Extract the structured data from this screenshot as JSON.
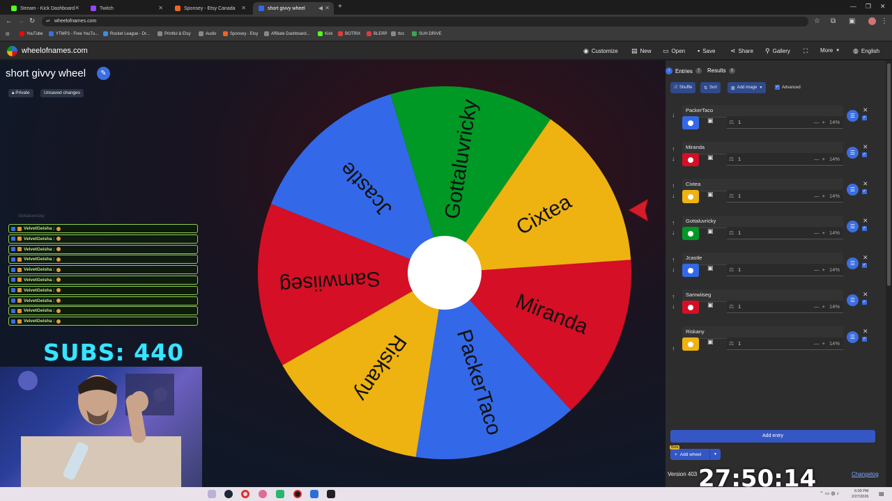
{
  "browser": {
    "tabs": [
      {
        "title": "Stream - Kick Dashboard",
        "color": "#53fc18"
      },
      {
        "title": "Twitch",
        "color": "#9146ff"
      },
      {
        "title": "Sponsey - Etsy Canada",
        "color": "#f1641e"
      },
      {
        "title": "short givvy wheel",
        "color": "#3369e8"
      }
    ],
    "url": "wheelofnames.com",
    "bookmarks": [
      {
        "label": "YouTube",
        "color": "#ff0000"
      },
      {
        "label": "YTMP3 - Free YouTu...",
        "color": "#3b6ee0"
      },
      {
        "label": "Rocket League - Dr...",
        "color": "#3b8ee0"
      },
      {
        "label": "Printful & Etsy",
        "color": "#888888"
      },
      {
        "label": "Audio",
        "color": "#888888"
      },
      {
        "label": "Sponsey - Etsy",
        "color": "#f1641e"
      },
      {
        "label": "Affiliate Dashboard...",
        "color": "#888888"
      },
      {
        "label": "Kick",
        "color": "#53fc18"
      },
      {
        "label": "BOTRIX",
        "color": "#e03b3b"
      },
      {
        "label": "BLERP",
        "color": "#e03b3b"
      },
      {
        "label": "ttcc",
        "color": "#888888"
      },
      {
        "label": "SUH DRIVE",
        "color": "#34a853"
      }
    ]
  },
  "header": {
    "site_name": "wheelofnames.com",
    "menu": [
      "Customize",
      "New",
      "Open",
      "Save",
      "Share",
      "Gallery",
      "More",
      "English"
    ]
  },
  "wheel": {
    "title": "short givvy wheel",
    "private_label": "Private",
    "unsaved_label": "Unsaved changes",
    "segments": [
      {
        "name": "Miranda",
        "color": "#d50f25"
      },
      {
        "name": "PackerTaco",
        "color": "#3369e8"
      },
      {
        "name": "Riskany",
        "color": "#eeb211"
      },
      {
        "name": "Samwiiseg",
        "color": "#d50f25"
      },
      {
        "name": "Jcastle",
        "color": "#3369e8"
      },
      {
        "name": "Gottaluvricky",
        "color": "#009925"
      },
      {
        "name": "Cixtea",
        "color": "#eeb211"
      }
    ]
  },
  "stream_overlay": {
    "chat_header": "Gottaluvricky",
    "chat_lines": [
      "VelvetGeisha :",
      "VelvetGeisha :",
      "VelvetGeisha :",
      "VelvetGeisha :",
      "VelvetGeisha :",
      "VelvetGeisha :",
      "VelvetGeisha :",
      "VelvetGeisha :",
      "VelvetGeisha :",
      "VelvetGeisha :"
    ],
    "subs_text": "SUBS: 440",
    "timer": "27:50:14"
  },
  "sidebar": {
    "tabs": [
      {
        "label": "Entries",
        "count": "7"
      },
      {
        "label": "Results",
        "count": "0"
      }
    ],
    "tools": {
      "shuffle": "Shuffle",
      "sort": "Sort",
      "add_image": "Add image",
      "advanced": "Advanced"
    },
    "entries": [
      {
        "name": "PackerTaco",
        "color": "#3369e8",
        "weight": "1",
        "percent": "14%"
      },
      {
        "name": "Miranda",
        "color": "#d50f25",
        "weight": "1",
        "percent": "14%"
      },
      {
        "name": "Cixtea",
        "color": "#eeb211",
        "weight": "1",
        "percent": "14%"
      },
      {
        "name": "Gottaluvricky",
        "color": "#009925",
        "weight": "1",
        "percent": "14%"
      },
      {
        "name": "Jcastle",
        "color": "#3369e8",
        "weight": "1",
        "percent": "14%"
      },
      {
        "name": "Samwiiseg",
        "color": "#d50f25",
        "weight": "1",
        "percent": "14%"
      },
      {
        "name": "Riskany",
        "color": "#eeb211",
        "weight": "1",
        "percent": "14%"
      }
    ],
    "add_entry": "Add entry",
    "add_wheel": "Add wheel",
    "beta": "Beta",
    "version": "Version 403",
    "changelog": "Changelog"
  },
  "taskbar": {
    "time": "6:09 PM",
    "date": "2/27/2026"
  }
}
